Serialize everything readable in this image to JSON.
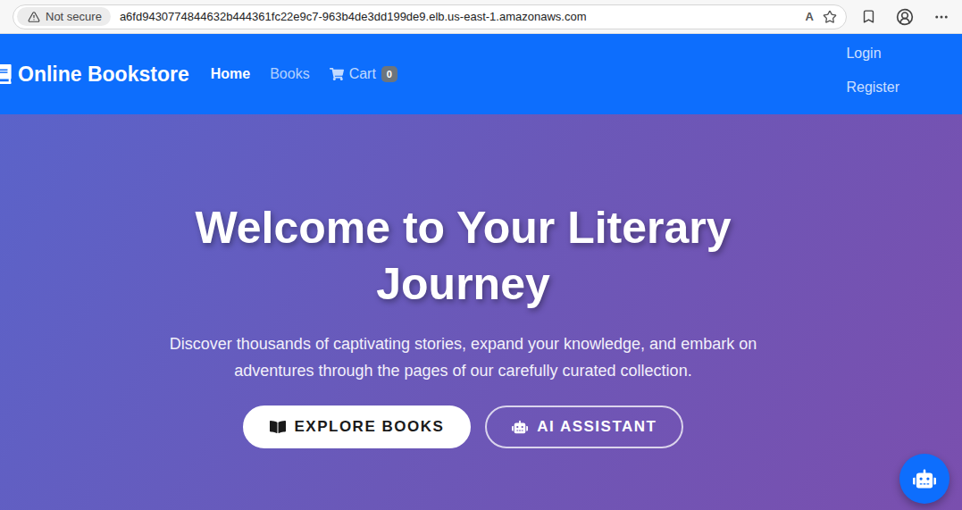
{
  "browser": {
    "security": "Not secure",
    "url": "a6fd9430774844632b444361fc22e9c7-963b4de3dd199de9.elb.us-east-1.amazonaws.com",
    "read_aloud": "A"
  },
  "navbar": {
    "brand": "Online Bookstore",
    "links": [
      {
        "label": "Home",
        "selected": true
      },
      {
        "label": "Books",
        "selected": false
      }
    ],
    "cart": {
      "label": "Cart",
      "count": "0"
    },
    "auth": [
      "Login",
      "Register"
    ]
  },
  "hero": {
    "title": "Welcome to Your Literary Journey",
    "subtitle": "Discover thousands of captivating stories, expand your knowledge, and embark on adventures through the pages of our carefully curated collection.",
    "buttons": [
      {
        "label": "EXPLORE BOOKS",
        "kind": "solid"
      },
      {
        "label": "AI ASSISTANT",
        "kind": "outline"
      }
    ]
  }
}
